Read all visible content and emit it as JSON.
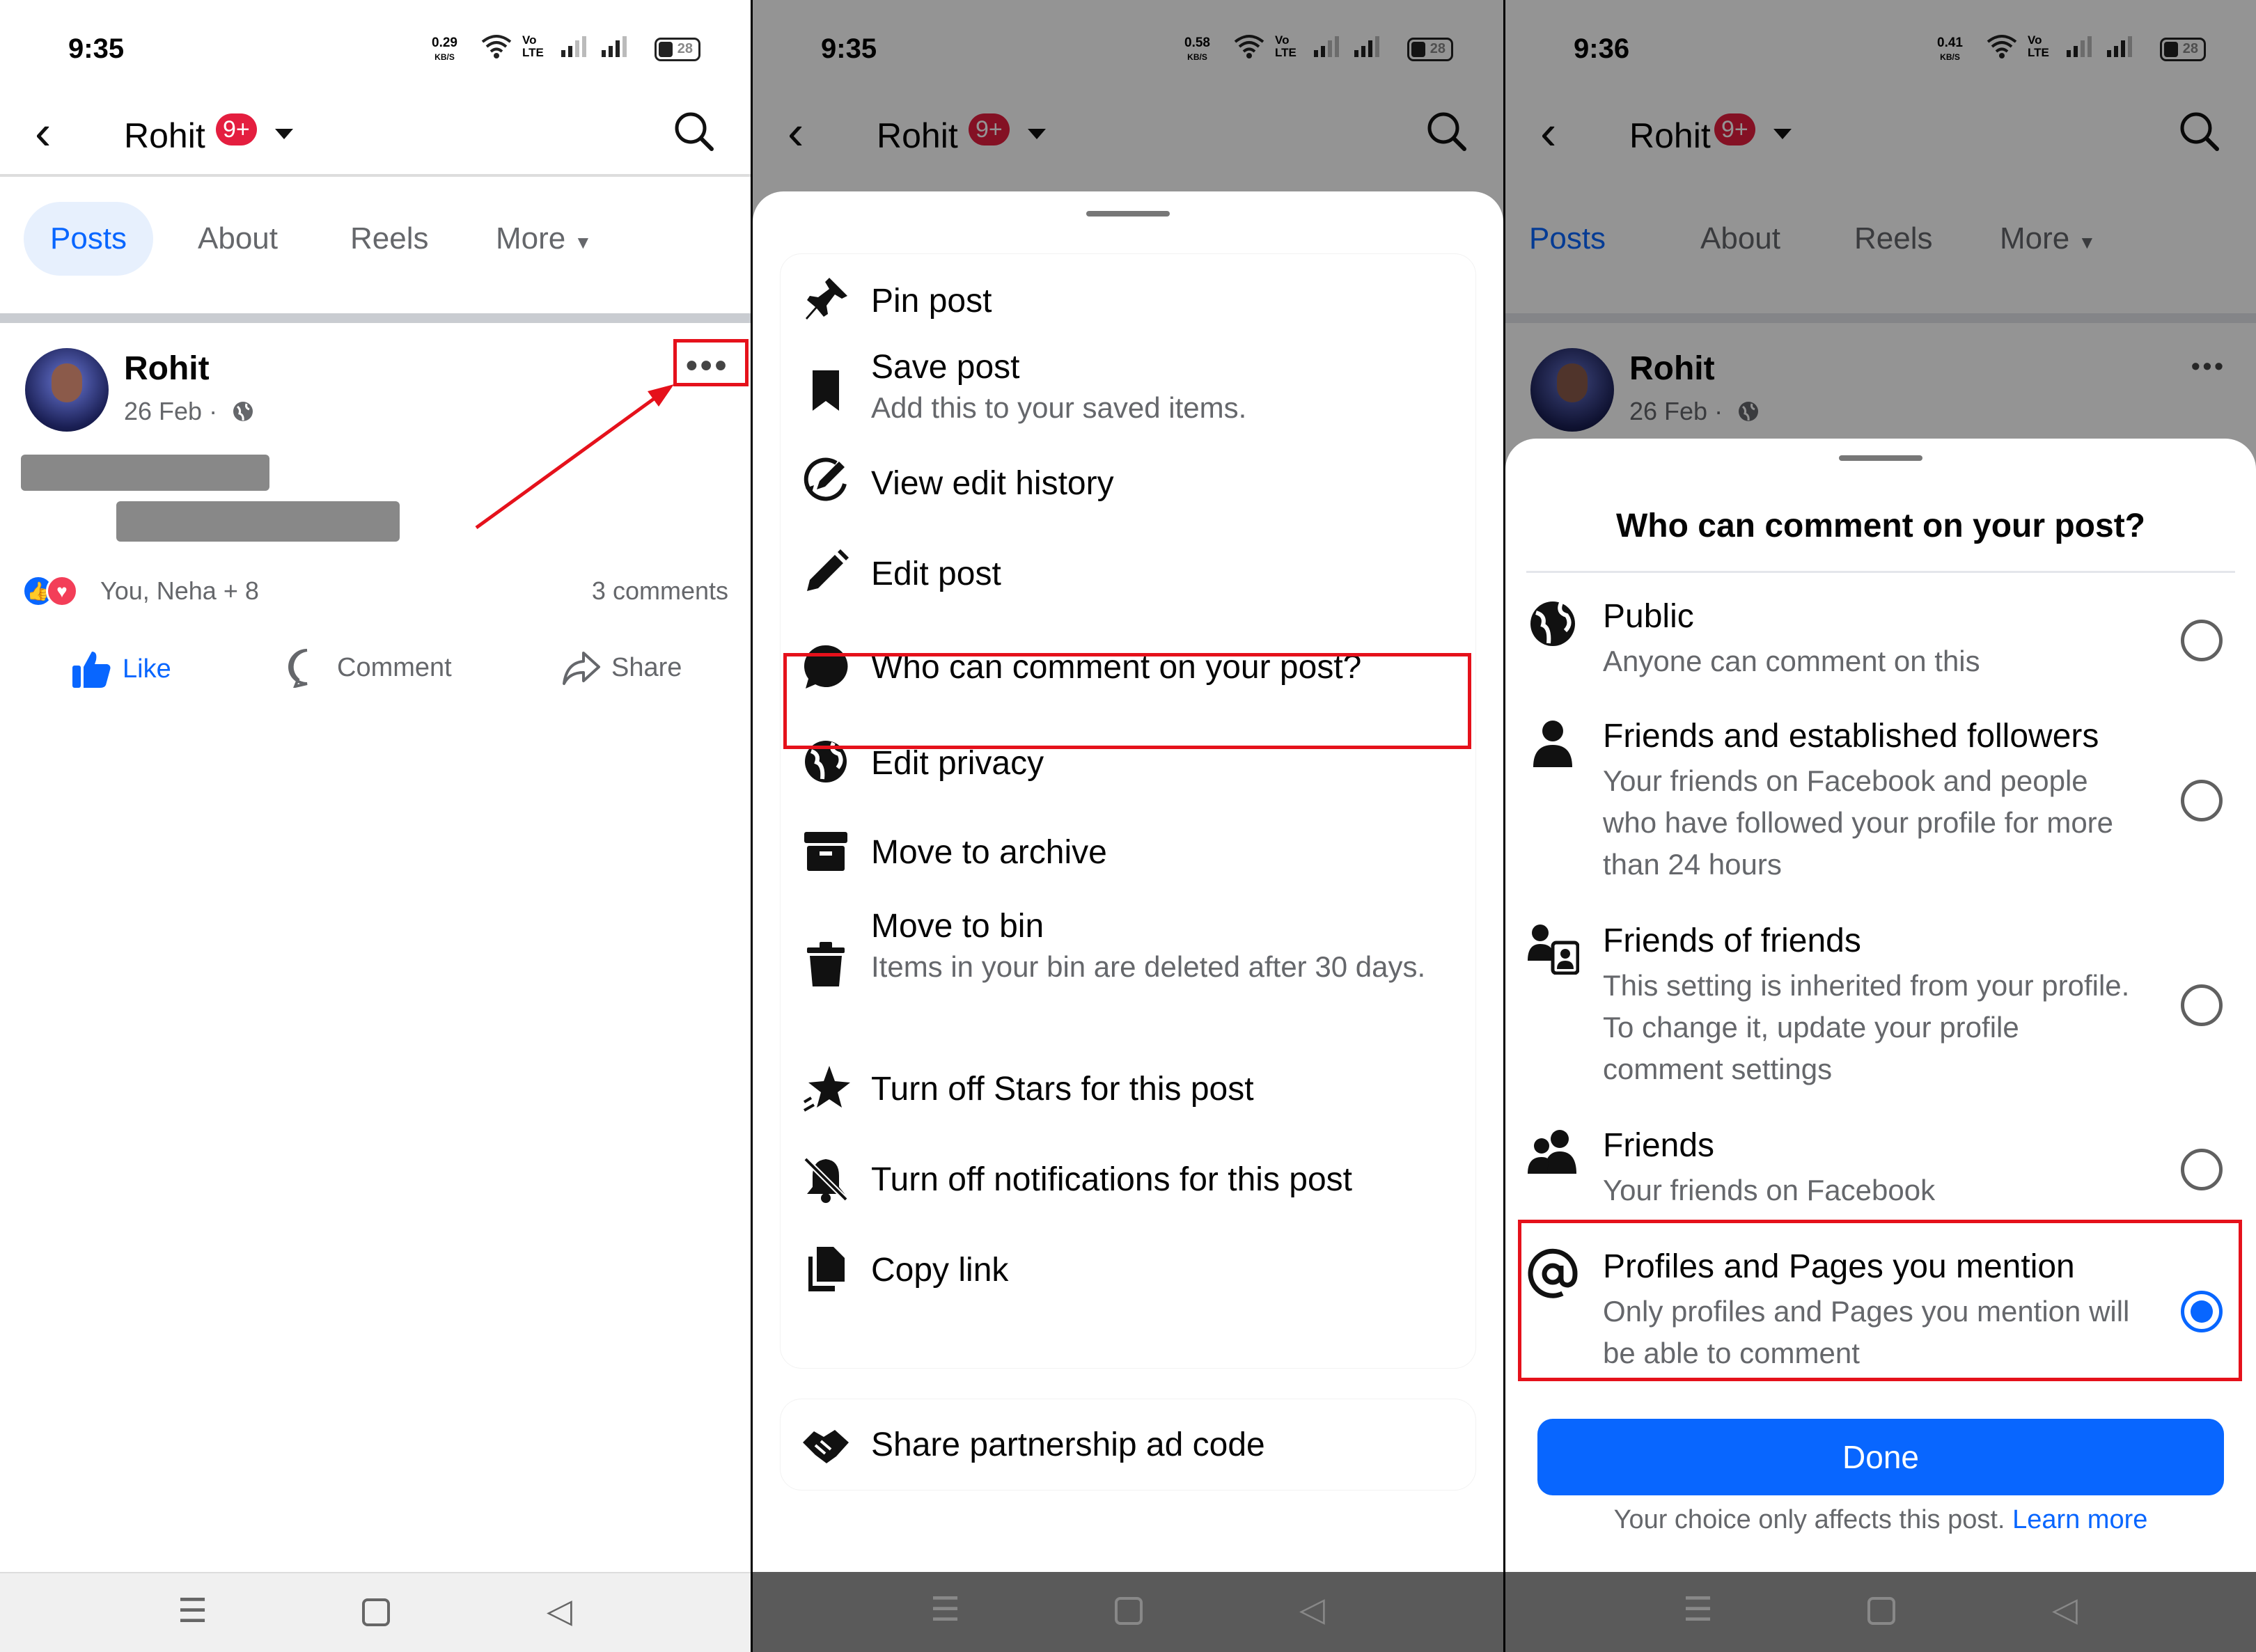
{
  "status": [
    {
      "time": "9:35",
      "speed": "0.29",
      "speed_unit": "KB/S",
      "net": "Vo LTE",
      "battery": "28"
    },
    {
      "time": "9:35",
      "speed": "0.58",
      "speed_unit": "KB/S",
      "net": "Vo LTE",
      "battery": "28"
    },
    {
      "time": "9:36",
      "speed": "0.41",
      "speed_unit": "KB/S",
      "net": "Vo LTE",
      "battery": "28"
    }
  ],
  "header": {
    "name": "Rohit",
    "badge": "9+"
  },
  "tabs": [
    "Posts",
    "About",
    "Reels",
    "More"
  ],
  "post": {
    "author": "Rohit",
    "date": "26 Feb",
    "reactions": "You, Neha + 8",
    "comments": "3 comments",
    "actions": {
      "like": "Like",
      "comment": "Comment",
      "share": "Share"
    }
  },
  "menu": {
    "items": [
      {
        "title": "Pin post",
        "icon": "pin-icon"
      },
      {
        "title": "Save post",
        "subtitle": "Add this to your saved items.",
        "icon": "bookmark-icon"
      },
      {
        "title": "View edit history",
        "icon": "edit-history-icon"
      },
      {
        "title": "Edit post",
        "icon": "pencil-icon"
      },
      {
        "title": "Who can comment on your post?",
        "icon": "comment-bubble-icon"
      },
      {
        "title": "Edit privacy",
        "icon": "globe-icon"
      },
      {
        "title": "Move to archive",
        "icon": "archive-icon"
      },
      {
        "title": "Move to bin",
        "subtitle": "Items in your bin are deleted after 30 days.",
        "icon": "trash-icon"
      },
      {
        "title": "Turn off Stars for this post",
        "icon": "star-icon"
      },
      {
        "title": "Turn off notifications for this post",
        "icon": "bell-off-icon"
      },
      {
        "title": "Copy link",
        "icon": "copy-icon"
      }
    ],
    "partnership": "Share partnership ad code"
  },
  "comment_dialog": {
    "title": "Who can comment on your post?",
    "options": [
      {
        "title": "Public",
        "subtitle": "Anyone can comment on this",
        "selected": false,
        "icon": "globe-icon"
      },
      {
        "title": "Friends and established followers",
        "subtitle": "Your friends on Facebook and people who have followed your profile for more than 24 hours",
        "selected": false,
        "icon": "person-icon"
      },
      {
        "title": "Friends of friends",
        "subtitle": "This setting is inherited from your profile. To change it, update your profile comment settings",
        "selected": false,
        "icon": "friends-of-friends-icon"
      },
      {
        "title": "Friends",
        "subtitle": "Your friends on Facebook",
        "selected": false,
        "icon": "friends-icon"
      },
      {
        "title": "Profiles and Pages you mention",
        "subtitle": "Only profiles and Pages you mention will be able to comment",
        "selected": true,
        "icon": "at-icon"
      }
    ],
    "done": "Done",
    "footer": "Your choice only affects this post.",
    "learn_more": "Learn more"
  },
  "colors": {
    "accent": "#0866ff",
    "highlight": "#e5111b",
    "badge": "#e41e3f"
  }
}
